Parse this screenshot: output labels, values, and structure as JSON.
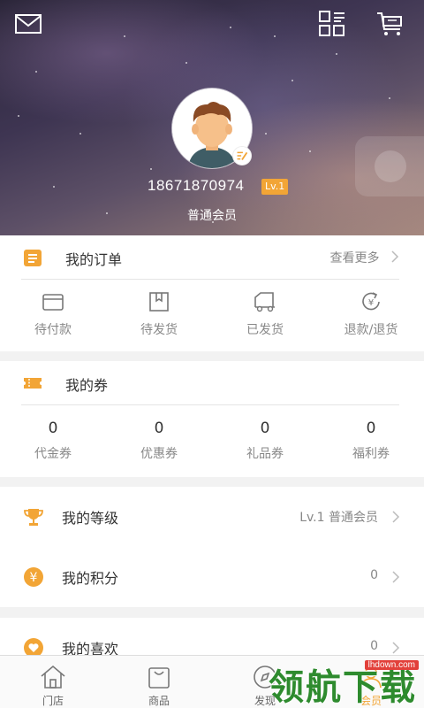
{
  "header": {
    "phone": "18671870974",
    "level_badge": "Lv.1",
    "member_type": "普通会员"
  },
  "orders": {
    "title": "我的订单",
    "more": "查看更多",
    "items": [
      {
        "label": "待付款",
        "icon": "wallet-icon"
      },
      {
        "label": "待发货",
        "icon": "box-icon"
      },
      {
        "label": "已发货",
        "icon": "truck-icon"
      },
      {
        "label": "退款/退货",
        "icon": "refund-icon"
      }
    ]
  },
  "coupons": {
    "title": "我的券",
    "items": [
      {
        "count": "0",
        "label": "代金券"
      },
      {
        "count": "0",
        "label": "优惠券"
      },
      {
        "count": "0",
        "label": "礼品券"
      },
      {
        "count": "0",
        "label": "福利券"
      }
    ]
  },
  "list": [
    {
      "title": "我的等级",
      "value": "Lv.1 普通会员",
      "icon": "trophy-icon"
    },
    {
      "title": "我的积分",
      "value": "0",
      "icon": "yen-icon"
    },
    {
      "title": "我的喜欢",
      "value": "0",
      "icon": "heart-icon"
    }
  ],
  "tabs": [
    {
      "label": "门店",
      "icon": "store-icon"
    },
    {
      "label": "商品",
      "icon": "bag-icon"
    },
    {
      "label": "发现",
      "icon": "discover-icon"
    },
    {
      "label": "会员",
      "icon": "member-icon"
    }
  ],
  "watermark": {
    "text": "领航下载",
    "url": "lhdown.com"
  },
  "colors": {
    "accent": "#f2a536",
    "text": "#333333",
    "muted": "#888888"
  }
}
